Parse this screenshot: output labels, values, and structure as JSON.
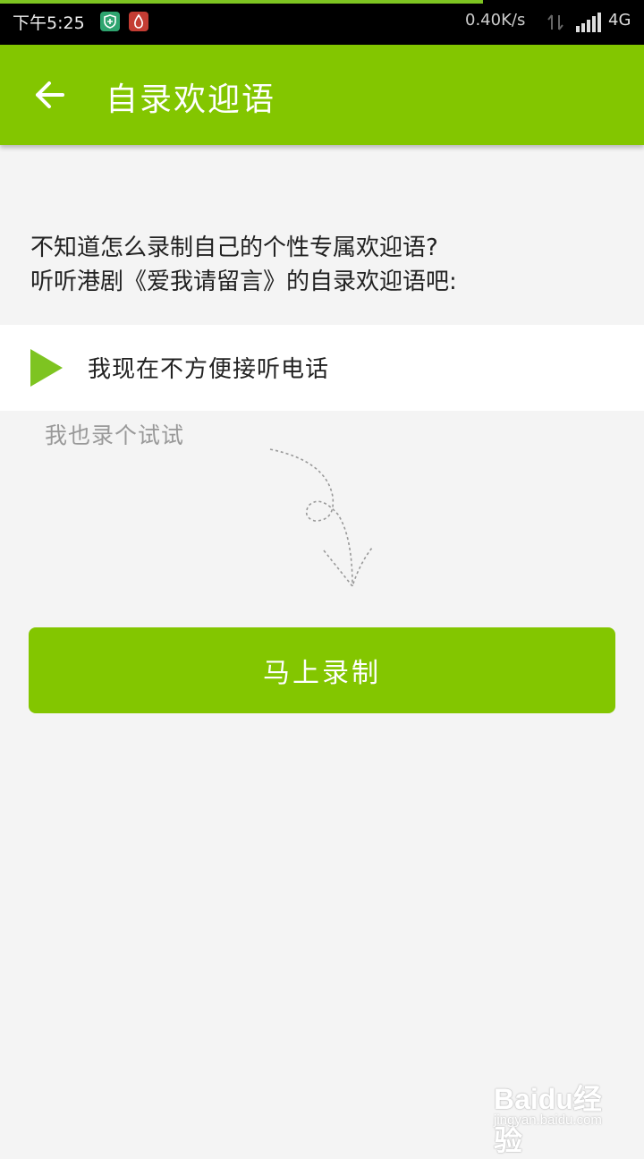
{
  "status_bar": {
    "time": "下午5:25",
    "net_speed": "0.40K/s",
    "network_type": "4G",
    "icons": [
      "shield-icon",
      "drop-icon",
      "data-transfer-icon",
      "signal-icon"
    ]
  },
  "app_bar": {
    "title": "自录欢迎语",
    "back_icon": "arrow-left-icon"
  },
  "intro": {
    "line1": "不知道怎么录制自己的个性专属欢迎语?",
    "line2": "听听港剧《爱我请留言》的自录欢迎语吧:"
  },
  "sample": {
    "label": "我现在不方便接听电话",
    "icon": "play-icon"
  },
  "try_label": "我也录个试试",
  "record_button": "马上录制",
  "watermark": {
    "logo": "Baidu经验",
    "url": "jingyan.baidu.com"
  },
  "colors": {
    "accent": "#83c600",
    "background": "#f4f4f4",
    "status_bar": "#000000"
  }
}
